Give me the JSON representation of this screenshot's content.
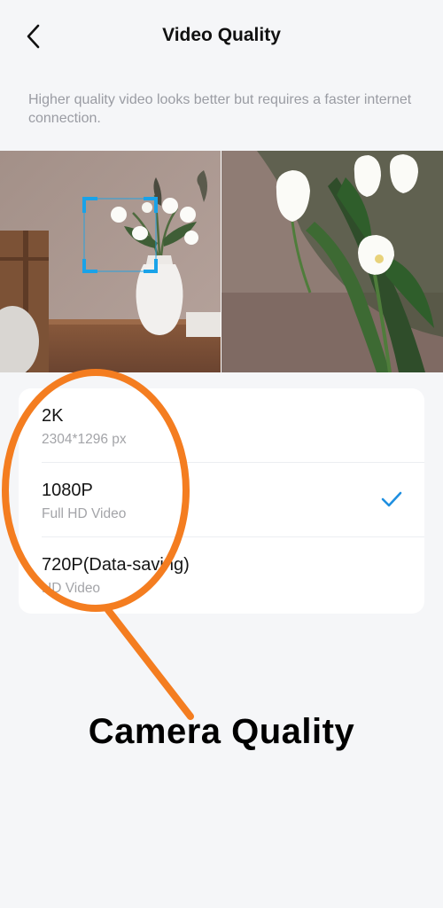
{
  "header": {
    "title": "Video Quality",
    "back_icon": "chevron-left-icon"
  },
  "description": "Higher quality video looks better but requires a faster internet connection.",
  "preview": {
    "left_image": "room-with-tulips-vase-focus-box",
    "right_image": "zoomed-white-tulips"
  },
  "options": [
    {
      "label": "2K",
      "sub": "2304*1296 px",
      "selected": false
    },
    {
      "label": "1080P",
      "sub": "Full HD Video",
      "selected": true
    },
    {
      "label": "720P(Data-saving)",
      "sub": "HD Video",
      "selected": false
    }
  ],
  "annotation": {
    "label": "Camera Quality",
    "color": "#f47d20"
  },
  "colors": {
    "accent": "#1f8fe0",
    "annotation": "#f47d20",
    "focus_box": "#1aa3e8"
  }
}
